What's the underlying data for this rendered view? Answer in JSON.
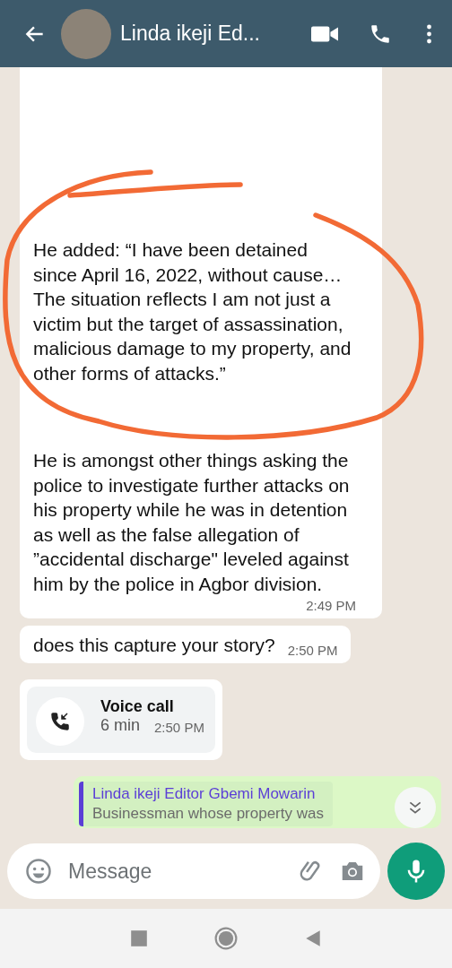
{
  "header": {
    "title": "Linda ikeji Ed..."
  },
  "messages": [
    {
      "kind": "text",
      "outgoing": false,
      "paragraphs": [
        "He added: “I have been detained since April 16, 2022, without cause… The situation reflects I am not just a victim but the target of assassination, malicious damage to my property, and other forms of attacks.”",
        "He is amongst other things asking the police to investigate further attacks on his property while he was in detention as well as the false allegation of ”accidental discharge\" leveled against him by the police in Agbor division."
      ],
      "time": "2:49 PM"
    },
    {
      "kind": "text",
      "outgoing": false,
      "paragraphs": [
        "does this capture your story?"
      ],
      "time": "2:50 PM"
    },
    {
      "kind": "call",
      "outgoing": false,
      "title": "Voice call",
      "duration": "6 min",
      "time": "2:50 PM"
    },
    {
      "kind": "quote",
      "outgoing": true,
      "author": "Linda ikeji Editor Gbemi Mowarin",
      "text": "Businessman whose property was"
    }
  ],
  "composer": {
    "placeholder": "Message"
  }
}
